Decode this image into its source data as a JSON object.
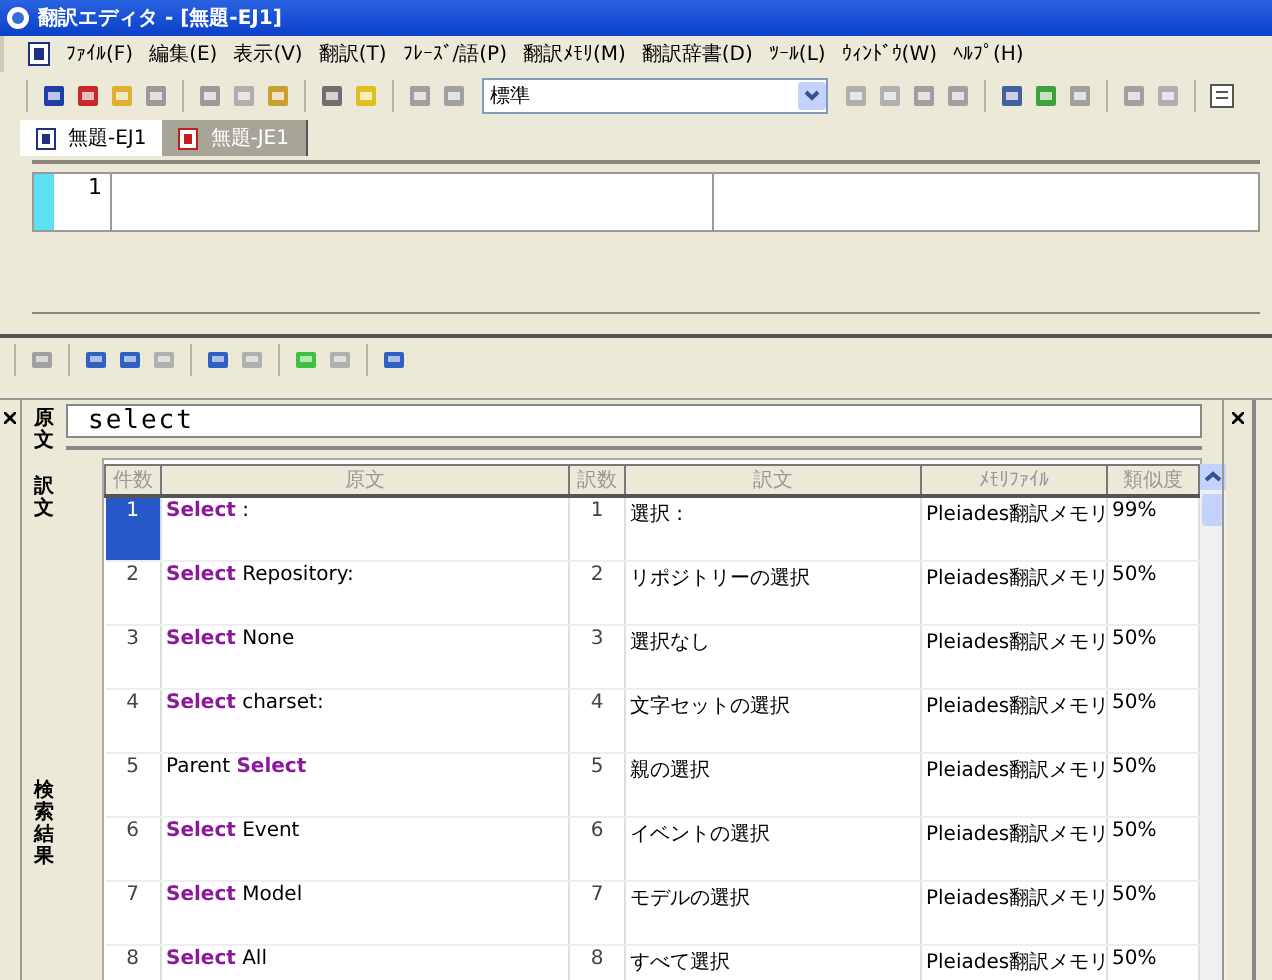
{
  "window": {
    "title": "翻訳エディタ - [無題-EJ1]"
  },
  "menu": [
    "ﾌｧｲﾙ(F)",
    "編集(E)",
    "表示(V)",
    "翻訳(T)",
    "ﾌﾚｰｽﾞ/語(P)",
    "翻訳ﾒﾓﾘ(M)",
    "翻訳辞書(D)",
    "ﾂｰﾙ(L)",
    "ｳｨﾝﾄﾞｳ(W)",
    "ﾍﾙﾌﾟ(H)"
  ],
  "mode_select": {
    "value": "標準"
  },
  "tabs": [
    {
      "label": "無題-EJ1",
      "selected": true
    },
    {
      "label": "無題-JE1",
      "selected": false
    }
  ],
  "editor": {
    "rows": [
      {
        "number": "1"
      }
    ]
  },
  "search": {
    "source_label": "原文",
    "source_value": "select",
    "target_label": "訳文",
    "results_label": "検索結果"
  },
  "table": {
    "columns": [
      "件数",
      "原文",
      "訳数",
      "訳文",
      "ﾒﾓﾘﾌｧｲﾙ",
      "類似度"
    ],
    "rows": [
      {
        "no": "1",
        "source": "**Select** :",
        "tno": "1",
        "target": "選択 :",
        "file": "Pleiades翻訳メモリ",
        "similarity": "99%",
        "selected": true
      },
      {
        "no": "2",
        "source": "**Select** Repository:",
        "tno": "2",
        "target": "リポジトリーの選択",
        "file": "Pleiades翻訳メモリ",
        "similarity": "50%",
        "selected": false
      },
      {
        "no": "3",
        "source": "**Select** None",
        "tno": "3",
        "target": "選択なし",
        "file": "Pleiades翻訳メモリ",
        "similarity": "50%",
        "selected": false
      },
      {
        "no": "4",
        "source": "**Select** charset:",
        "tno": "4",
        "target": "文字セットの選択",
        "file": "Pleiades翻訳メモリ",
        "similarity": "50%",
        "selected": false
      },
      {
        "no": "5",
        "source": "Parent **Select**",
        "tno": "5",
        "target": "親の選択",
        "file": "Pleiades翻訳メモリ",
        "similarity": "50%",
        "selected": false
      },
      {
        "no": "6",
        "source": "**Select** Event",
        "tno": "6",
        "target": "イベントの選択",
        "file": "Pleiades翻訳メモリ",
        "similarity": "50%",
        "selected": false
      },
      {
        "no": "7",
        "source": "**Select** Model",
        "tno": "7",
        "target": "モデルの選択",
        "file": "Pleiades翻訳メモリ",
        "similarity": "50%",
        "selected": false
      },
      {
        "no": "8",
        "source": "**Select** All",
        "tno": "8",
        "target": "すべて選択",
        "file": "Pleiades翻訳メモリ",
        "similarity": "50%",
        "selected": false
      }
    ]
  }
}
